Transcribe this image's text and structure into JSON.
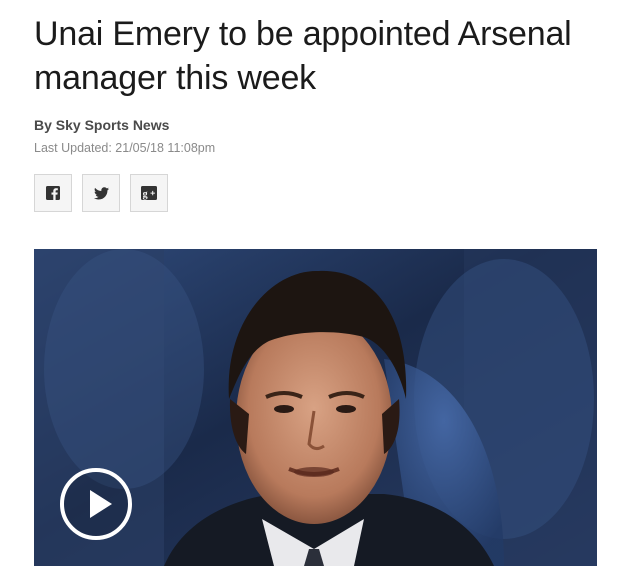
{
  "article": {
    "headline": "Unai Emery to be appointed Arsenal manager this week",
    "byline": "By Sky Sports News",
    "last_updated": "Last Updated: 21/05/18 11:08pm"
  },
  "share": {
    "buttons": [
      {
        "icon": "facebook-icon"
      },
      {
        "icon": "twitter-icon"
      },
      {
        "icon": "google-plus-icon"
      }
    ]
  },
  "media": {
    "play_icon": "play-icon"
  },
  "colors": {
    "headline": "#1b1b1b",
    "byline": "#4a4a4a",
    "updated": "#8a8a8a",
    "share_bg": "#f5f5f5",
    "share_border": "#d6d6d6",
    "icon": "#333333"
  }
}
